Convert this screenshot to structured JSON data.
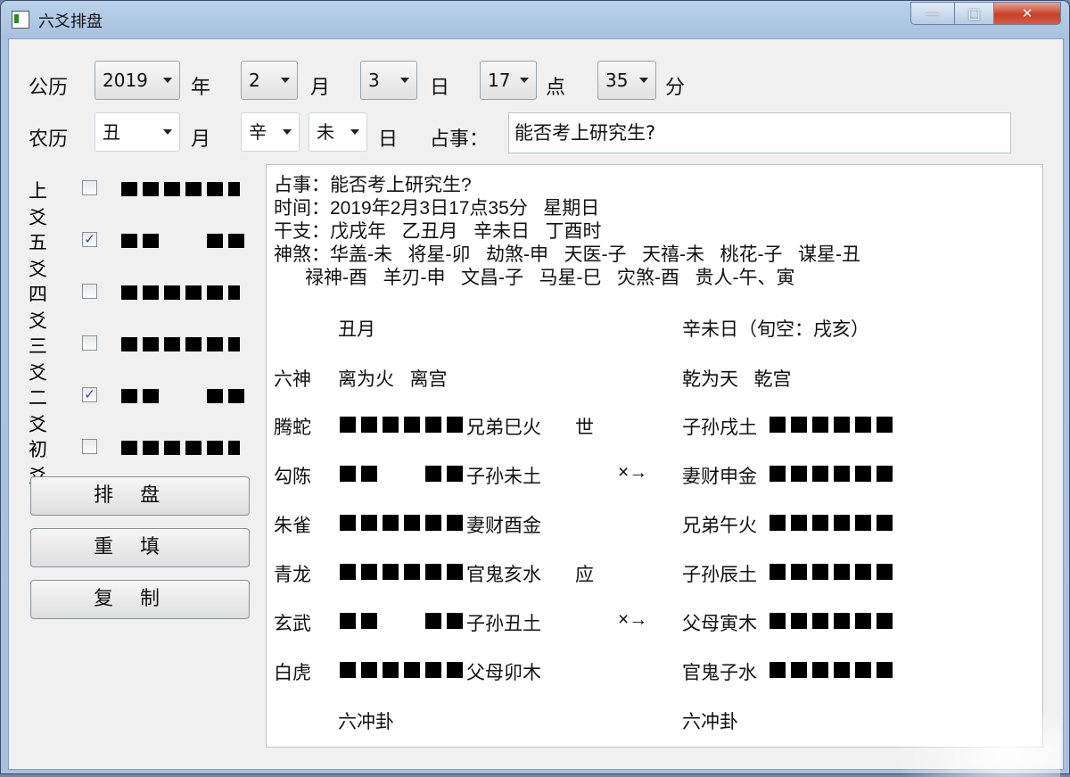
{
  "window": {
    "title": "六爻排盘",
    "minimize": "—",
    "maximize": "□",
    "close": "✕"
  },
  "solar": {
    "label": "公历",
    "year": "2019",
    "year_unit": "年",
    "month": "2",
    "month_unit": "月",
    "day": "3",
    "day_unit": "日",
    "hour": "17",
    "hour_unit": "点",
    "minute": "35",
    "minute_unit": "分"
  },
  "lunar": {
    "label": "农历",
    "month": "丑",
    "month_unit": "月",
    "day_stem": "辛",
    "day_branch": "未",
    "day_unit": "日",
    "question_label": "占事：",
    "question": "能否考上研究生?"
  },
  "yao": [
    {
      "label": "上爻",
      "checked": false,
      "type": "yang"
    },
    {
      "label": "五爻",
      "checked": true,
      "type": "yin"
    },
    {
      "label": "四爻",
      "checked": false,
      "type": "yang"
    },
    {
      "label": "三爻",
      "checked": false,
      "type": "yang"
    },
    {
      "label": "二爻",
      "checked": true,
      "type": "yin"
    },
    {
      "label": "初爻",
      "checked": false,
      "type": "yang"
    }
  ],
  "buttons": {
    "arrange": "排盘",
    "reset": "重填",
    "copy": "复制"
  },
  "result": {
    "header": [
      "占事：能否考上研究生?",
      "时间：2019年2月3日17点35分   星期日",
      "干支：戊戌年   乙丑月   辛未日   丁酉时",
      "神煞：华盖-未   将星-卯   劫煞-申   天医-子   天禧-未   桃花-子   谋星-丑",
      "      禄神-酉   羊刃-申   文昌-子   马星-巳   灾煞-酉   贵人-午、寅"
    ],
    "month": "丑月",
    "day_info": "辛未日（旬空：戌亥）",
    "six_gods_title": "六神",
    "main_hex": "离为火   离宫",
    "changed_hex": "乾为天   乾宫",
    "rows": [
      {
        "god": "腾蛇",
        "main": "yang",
        "main_label": "兄弟巳火",
        "marker": "世",
        "change": "",
        "changed_label": "子孙戌土",
        "changed": "yang"
      },
      {
        "god": "勾陈",
        "main": "yin",
        "main_label": "子孙未土",
        "marker": "",
        "change": "×→",
        "changed_label": "妻财申金",
        "changed": "yang"
      },
      {
        "god": "朱雀",
        "main": "yang",
        "main_label": "妻财酉金",
        "marker": "",
        "change": "",
        "changed_label": "兄弟午火",
        "changed": "yang"
      },
      {
        "god": "青龙",
        "main": "yang",
        "main_label": "官鬼亥水",
        "marker": "应",
        "change": "",
        "changed_label": "子孙辰土",
        "changed": "yang"
      },
      {
        "god": "玄武",
        "main": "yin",
        "main_label": "子孙丑土",
        "marker": "",
        "change": "×→",
        "changed_label": "父母寅木",
        "changed": "yang"
      },
      {
        "god": "白虎",
        "main": "yang",
        "main_label": "父母卯木",
        "marker": "",
        "change": "",
        "changed_label": "官鬼子水",
        "changed": "yang"
      }
    ],
    "main_footer": "六冲卦",
    "changed_footer": "六冲卦"
  }
}
